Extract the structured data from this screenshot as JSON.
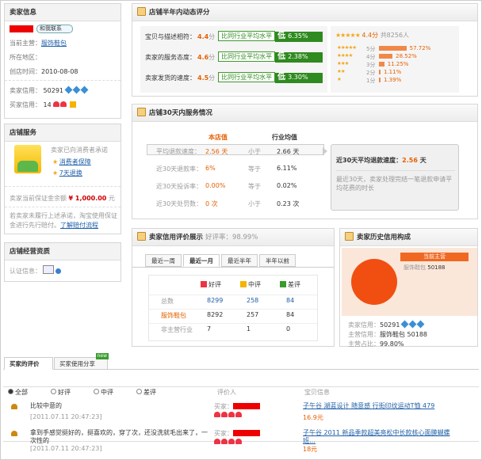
{
  "seller": {
    "header": "卖家信息",
    "contact": "和我联系",
    "main_label": "当前主营：",
    "main_value": "服饰鞋包",
    "loc_label": "所在地区：",
    "time_label": "创店时间：",
    "time_value": "2010-08-08",
    "credit_label": "卖家信用：",
    "credit_value": "50291",
    "buyer_credit_label": "买家信用：",
    "buyer_credit_value": "14"
  },
  "service": {
    "header": "店铺服务",
    "line1": "卖家已向消费者承诺",
    "item1": "消费者保障",
    "item2": "7天退换",
    "deposit_label": "卖家当前保证金余额",
    "deposit_value": "¥ 1,000.00",
    "deposit_unit": "元",
    "note": "若卖家未履行上述承诺，淘宝使用保证金进行先行赔付。",
    "note_link": "了解赔付流程"
  },
  "qual": {
    "header": "店铺经营资质",
    "label": "认证信息："
  },
  "dsr": {
    "header": "店铺半年内动态评分",
    "rows": [
      {
        "label": "宝贝与描述相符：",
        "score": "4.4",
        "unit": "分",
        "cmp": "比同行业平均水平",
        "tag": "低",
        "pct": "6.35%"
      },
      {
        "label": "卖家的服务态度：",
        "score": "4.6",
        "unit": "分",
        "cmp": "比同行业平均水平",
        "tag": "低",
        "pct": "2.38%"
      },
      {
        "label": "卖家发货的速度：",
        "score": "4.5",
        "unit": "分",
        "cmp": "比同行业平均水平",
        "tag": "低",
        "pct": "3.30%"
      }
    ],
    "summary_score": "4.4分",
    "summary_count": "共8256人",
    "dist": [
      {
        "label": "5分",
        "pct": "57.72%",
        "v": 57.72
      },
      {
        "label": "4分",
        "pct": "28.52%",
        "v": 28.52
      },
      {
        "label": "3分",
        "pct": "11.25%",
        "v": 11.25
      },
      {
        "label": "2分",
        "pct": "1.11%",
        "v": 1.11
      },
      {
        "label": "1分",
        "pct": "1.39%",
        "v": 1.39
      }
    ]
  },
  "svc30": {
    "header": "店铺30天内服务情况",
    "col_shop": "本店值",
    "col_avg": "行业均值",
    "rows": [
      {
        "label": "平均退款速度：",
        "shop": "2.56 天",
        "cmp": "小于",
        "avg": "2.66 天"
      },
      {
        "label": "近30天退款率：",
        "shop": "6%",
        "cmp": "等于",
        "avg": "6.11%"
      },
      {
        "label": "近30天投诉率：",
        "shop": "0.00%",
        "cmp": "等于",
        "avg": "0.02%"
      },
      {
        "label": "近30天处罚数：",
        "shop": "0 次",
        "cmp": "小于",
        "avg": "0.23 次"
      }
    ],
    "side_title": "近30天平均退款速度：",
    "side_value": "2.56",
    "side_unit": "天",
    "side_desc": "最近30天，卖家处理完结一笔退款申请平均花费的时长"
  },
  "credit": {
    "header": "卖家信用评价展示",
    "good_rate_label": "好评率：",
    "good_rate": "98.99%",
    "tabs": [
      "最近一周",
      "最近一月",
      "最近半年",
      "半年以前"
    ],
    "cols": [
      "好评",
      "中评",
      "差评"
    ],
    "rows": [
      {
        "label": "总数",
        "v": [
          "8299",
          "258",
          "84"
        ]
      },
      {
        "label": "服饰鞋包",
        "v": [
          "8292",
          "257",
          "84"
        ]
      },
      {
        "label": "非主营行业",
        "v": [
          "7",
          "1",
          "0"
        ]
      }
    ]
  },
  "history": {
    "header": "卖家历史信用构成",
    "legend_title": "当前主营",
    "legend_item": "服饰鞋包",
    "legend_value": "50188",
    "credit_label": "卖家信用：",
    "credit_value": "50291",
    "main_label": "主营信用：",
    "main_value": "服饰鞋包",
    "main_num": "50188",
    "ratio_label": "主营占比：",
    "ratio_value": "99.80%"
  },
  "reviews": {
    "tab1": "买家的评价",
    "tab2": "买家使用分享",
    "tab2_badge": "new",
    "filters": [
      "全部",
      "好评",
      "中评",
      "差评"
    ],
    "col_rater": "评价人",
    "col_item": "宝贝信息",
    "items": [
      {
        "text": "比较中意的",
        "time": "[2011.07.11 20:47:23]",
        "rater": "买家：",
        "item": "子午谷 湖蓝设计 随意感 行街印纹运动T恤 479",
        "price": "16.9元"
      },
      {
        "text": "拿到手感觉挺好的，挺喜欢的，穿了次，还没洗就毛出来了，一次性的",
        "time": "[2011.07.11 20:47:23]",
        "rater": "买家：",
        "item": "子午谷 2011 新品季款超美亮松中长款核心面膜蝴蝶班…",
        "price": "18元"
      }
    ]
  }
}
